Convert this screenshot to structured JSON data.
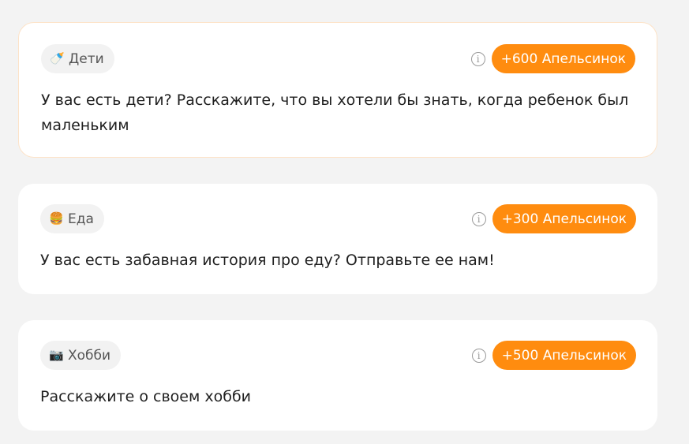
{
  "cards": [
    {
      "tag": {
        "icon": "🍼",
        "label": "Дети"
      },
      "reward": "+600 Апельсинок",
      "info_glyph": "i",
      "prompt": "У вас есть дети? Расскажите, что вы хотели бы знать, когда ребенок был маленьким"
    },
    {
      "tag": {
        "icon": "🍔",
        "label": "Еда"
      },
      "reward": "+300 Апельсинок",
      "info_glyph": "i",
      "prompt": "У вас есть забавная история про еду? Отправьте ее нам!"
    },
    {
      "tag": {
        "icon": "📷",
        "label": "Хобби"
      },
      "reward": "+500 Апельсинок",
      "info_glyph": "i",
      "prompt": "Расскажите о своем хобби"
    }
  ],
  "colors": {
    "accent": "#ff8c0f",
    "tag_bg": "#f2f2f2",
    "page_bg": "#f3f3f3",
    "card_bg": "#ffffff",
    "highlight_border": "#fde3c8"
  }
}
